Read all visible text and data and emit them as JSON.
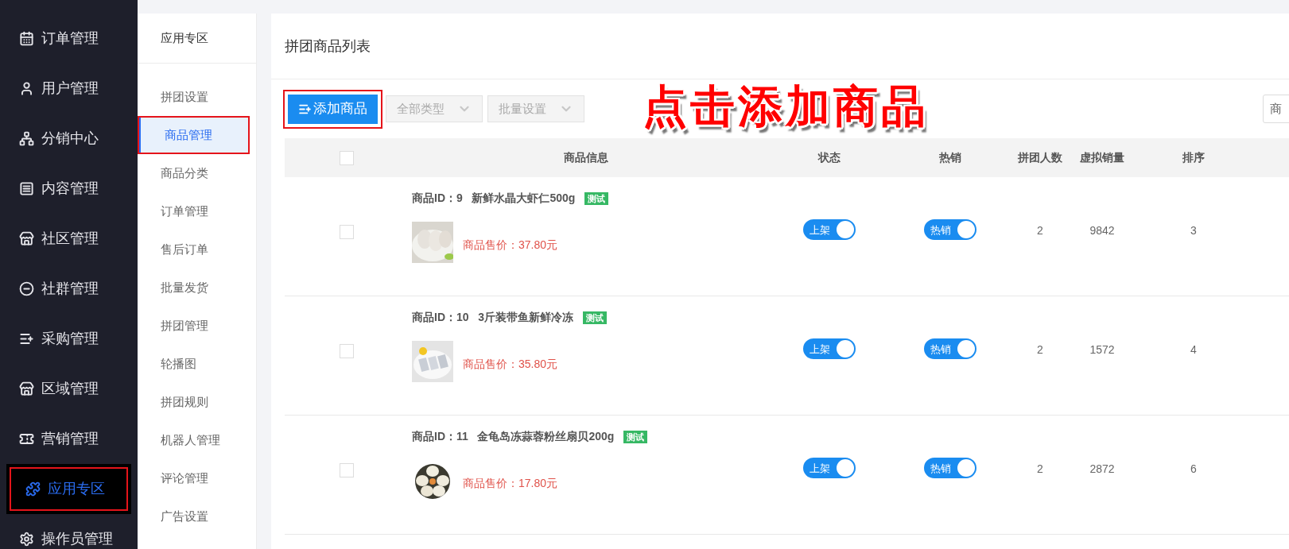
{
  "sidebar": {
    "items": [
      {
        "label": "订单管理",
        "selected": false,
        "highlighted": false
      },
      {
        "label": "用户管理",
        "selected": false,
        "highlighted": false
      },
      {
        "label": "分销中心",
        "selected": false,
        "highlighted": false
      },
      {
        "label": "内容管理",
        "selected": false,
        "highlighted": false
      },
      {
        "label": "社区管理",
        "selected": false,
        "highlighted": false
      },
      {
        "label": "社群管理",
        "selected": false,
        "highlighted": false
      },
      {
        "label": "采购管理",
        "selected": false,
        "highlighted": false
      },
      {
        "label": "区域管理",
        "selected": false,
        "highlighted": false
      },
      {
        "label": "营销管理",
        "selected": false,
        "highlighted": false
      },
      {
        "label": "应用专区",
        "selected": true,
        "highlighted": true
      },
      {
        "label": "操作员管理",
        "selected": false,
        "highlighted": false
      }
    ]
  },
  "submenu": {
    "title": "应用专区",
    "items": [
      {
        "label": "拼团设置",
        "selected": false,
        "highlighted": false
      },
      {
        "label": "商品管理",
        "selected": true,
        "highlighted": true
      },
      {
        "label": "商品分类",
        "selected": false,
        "highlighted": false
      },
      {
        "label": "订单管理",
        "selected": false,
        "highlighted": false
      },
      {
        "label": "售后订单",
        "selected": false,
        "highlighted": false
      },
      {
        "label": "批量发货",
        "selected": false,
        "highlighted": false
      },
      {
        "label": "拼团管理",
        "selected": false,
        "highlighted": false
      },
      {
        "label": "轮播图",
        "selected": false,
        "highlighted": false
      },
      {
        "label": "拼团规则",
        "selected": false,
        "highlighted": false
      },
      {
        "label": "机器人管理",
        "selected": false,
        "highlighted": false
      },
      {
        "label": "评论管理",
        "selected": false,
        "highlighted": false
      },
      {
        "label": "广告设置",
        "selected": false,
        "highlighted": false
      }
    ]
  },
  "page": {
    "title": "拼团商品列表"
  },
  "toolbar": {
    "add_button": {
      "label": "添加商品",
      "highlighted": true
    },
    "filters": [
      {
        "label": "全部类型"
      },
      {
        "label": "批量设置"
      }
    ],
    "search": {
      "placeholder": "商"
    }
  },
  "annotation": {
    "text": "点击添加商品"
  },
  "table": {
    "columns": [
      "商品信息",
      "状态",
      "热销",
      "拼团人数",
      "虚拟销量",
      "排序"
    ],
    "header_checked": false,
    "rows": [
      {
        "checked": false,
        "product": "商品ID：9   新鲜水晶大虾仁500g",
        "tag": "测试",
        "price": "商品售价：37.80元",
        "status": {
          "label": "上架",
          "on": true
        },
        "hot": {
          "label": "热销",
          "on": true
        },
        "group_size": "2",
        "virtual_sales": "9842",
        "sort": "3"
      },
      {
        "checked": false,
        "product": "商品ID：10   3斤装带鱼新鲜冷冻",
        "tag": "测试",
        "price": "商品售价：35.80元",
        "status": {
          "label": "上架",
          "on": true
        },
        "hot": {
          "label": "热销",
          "on": true
        },
        "group_size": "2",
        "virtual_sales": "1572",
        "sort": "4"
      },
      {
        "checked": false,
        "product": "商品ID：11   金龟岛冻蒜蓉粉丝扇贝200g",
        "tag": "测试",
        "price": "商品售价：17.80元",
        "status": {
          "label": "上架",
          "on": true
        },
        "hot": {
          "label": "热销",
          "on": true
        },
        "group_size": "2",
        "virtual_sales": "2872",
        "sort": "6"
      }
    ]
  }
}
